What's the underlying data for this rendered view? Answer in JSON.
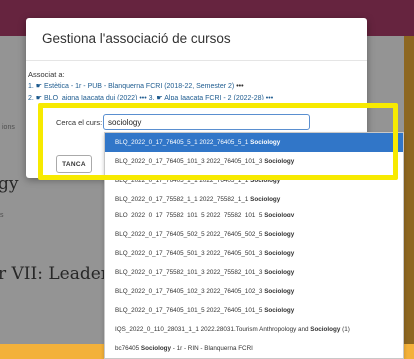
{
  "background_page": {
    "crumb": "ions",
    "heading_fragment": "gy",
    "small_fragment": "s",
    "heading2": "r VII: Leadership"
  },
  "modal": {
    "title": "Gestiona l'associació de cursos",
    "associated_label": "Associat a:",
    "assoc_item_1": "1. ☛ Estètica - 1r - PUB - Blanquerna FCRI (2018-22, Semester 2)",
    "assoc_item_1_more": "•••",
    "assoc_item_2": "2. ☛ BLQ_aigna Iaacata dui (2022) •••   3. ☛ Alpa Iaacata FCRI - 2 (2022-28) •••",
    "search_label": "Cerca el curs:",
    "search_value": "sociology",
    "close_button": "TANCA"
  },
  "dropdown": {
    "results": [
      {
        "prefix": "BLQ_2022_0_17_76405_5_1 2022_76405_5_1 ",
        "match": "Sociology",
        "suffix": ""
      },
      {
        "prefix": "BLQ_2022_0_17_76405_101_3 2022_76405_101_3 ",
        "match": "Sociology",
        "suffix": ""
      },
      {
        "prefix": "BLQ_2022_0_17_76405_1_1 2022_76405_1_1 ",
        "match": "Sociology",
        "suffix": ""
      },
      {
        "prefix": "BLQ_2022_0_17_75582_1_1 2022_75582_1_1 ",
        "match": "Sociology",
        "suffix": ""
      },
      {
        "prefix": "BLQ_2022_0_17_75582_101_5 2022_75582_101_5 ",
        "match": "Sociology",
        "suffix": ""
      },
      {
        "prefix": "BLQ_2022_0_17_76405_502_5 2022_76405_502_5 ",
        "match": "Sociology",
        "suffix": ""
      },
      {
        "prefix": "BLQ_2022_0_17_76405_501_3 2022_76405_501_3 ",
        "match": "Sociology",
        "suffix": ""
      },
      {
        "prefix": "BLQ_2022_0_17_75582_101_3 2022_75582_101_3 ",
        "match": "Sociology",
        "suffix": ""
      },
      {
        "prefix": "BLQ_2022_0_17_76405_102_3 2022_76405_102_3 ",
        "match": "Sociology",
        "suffix": ""
      },
      {
        "prefix": "BLQ_2022_0_17_76405_101_5 2022_76405_101_5 ",
        "match": "Sociology",
        "suffix": ""
      },
      {
        "prefix": "IQS_2022_0_110_28031_1_1 2022.28031.Tourism Anthropology and ",
        "match": "Sociology",
        "suffix": " (1)"
      },
      {
        "prefix": "bc76405 ",
        "match": "Sociology",
        "suffix": " - 1r - RIN - Blanquerna FCRI"
      }
    ]
  },
  "colors": {
    "app_bar": "#b03f6d",
    "backdrop": "#f3b13a",
    "highlight": "#f7ea00",
    "active_item": "#3176c8",
    "link": "#1d5b8f"
  }
}
